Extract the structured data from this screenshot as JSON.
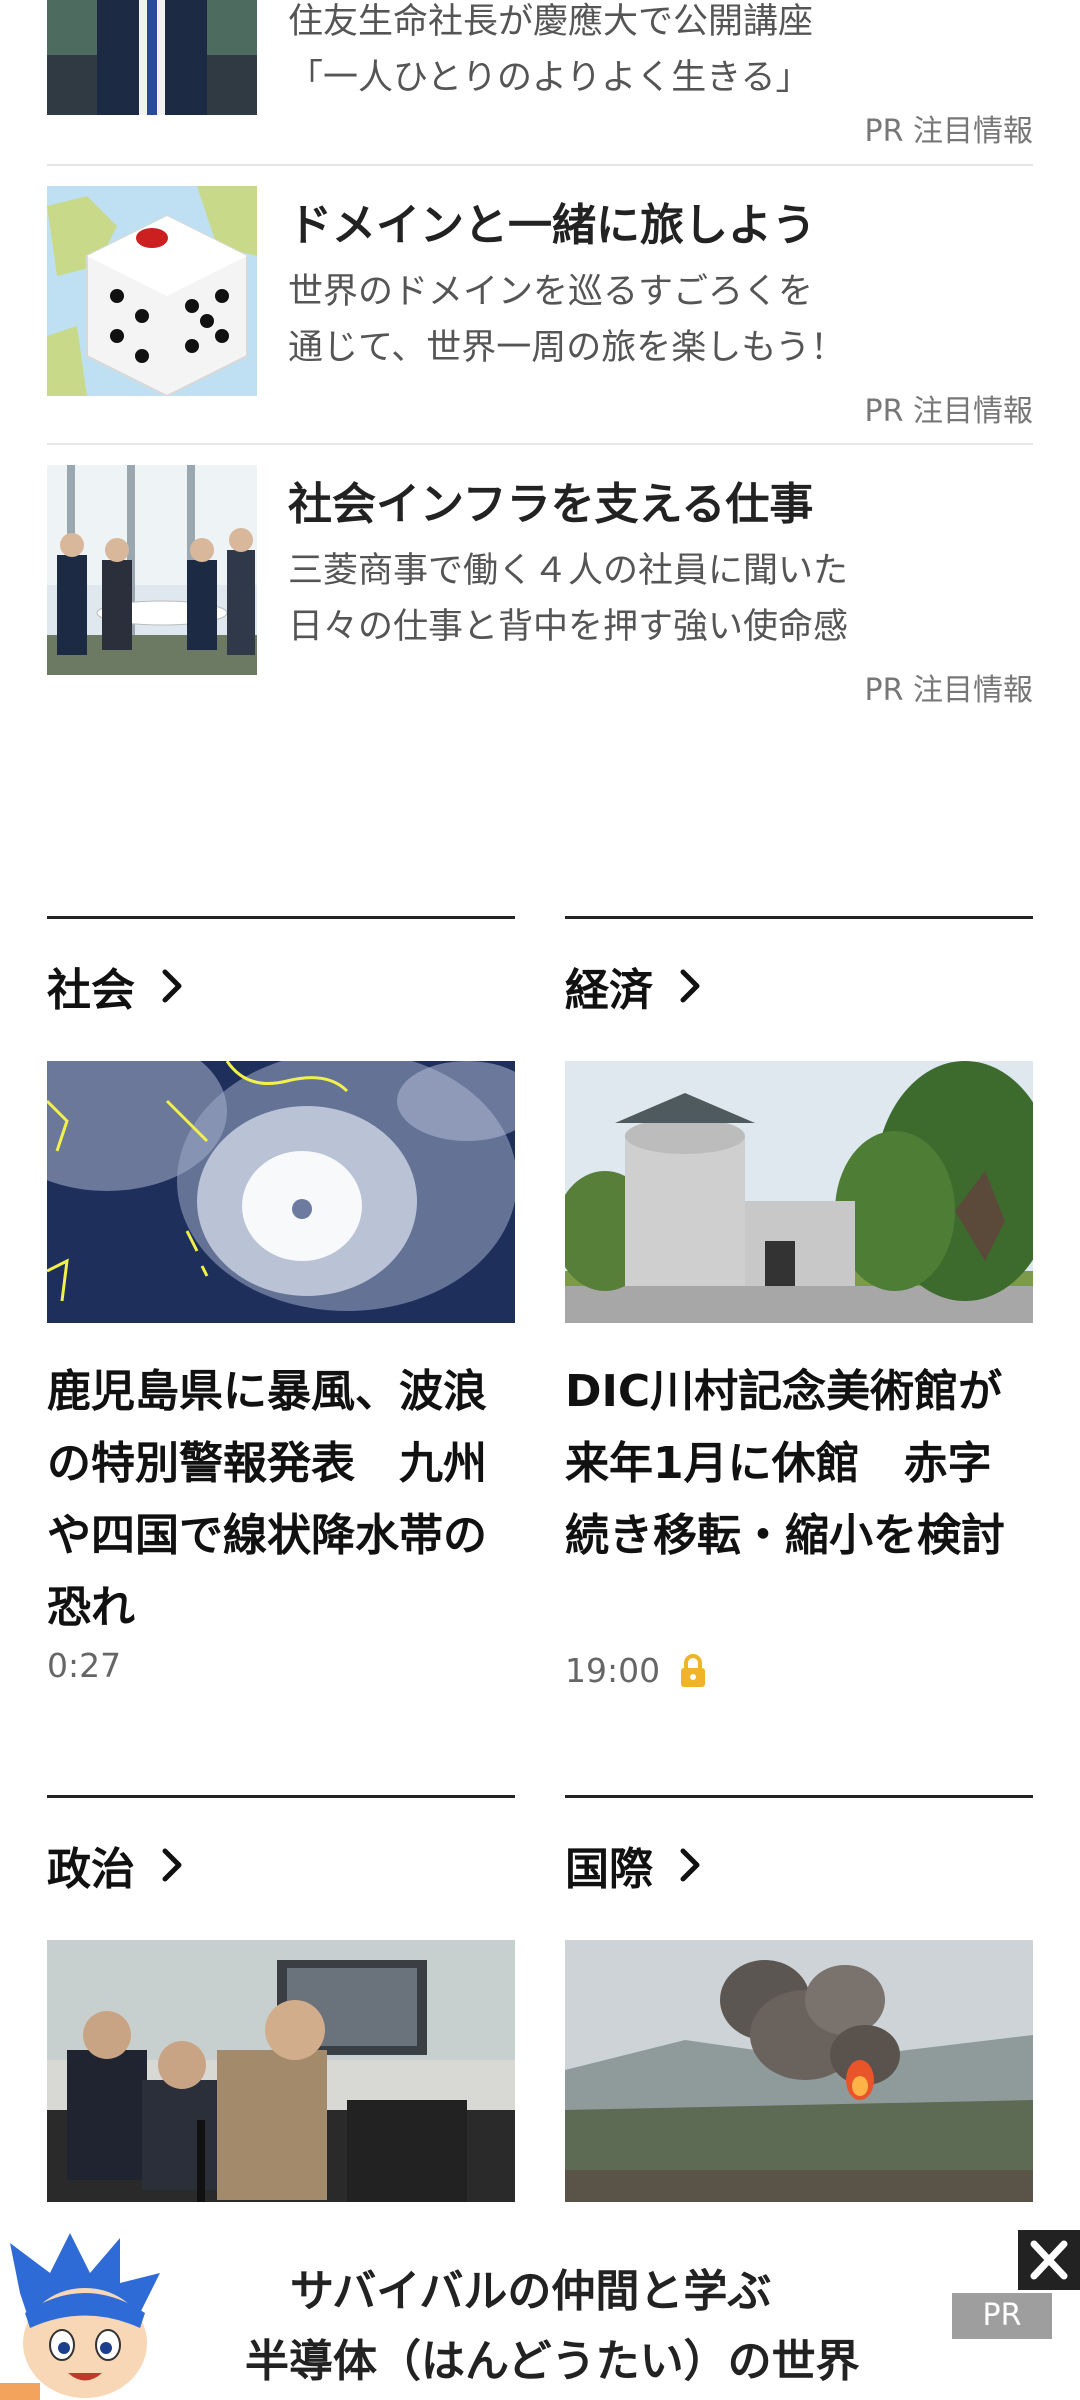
{
  "pr_items": [
    {
      "title": "住友生命社長が慶應大で公開講座",
      "desc": "「一人ひとりのよりよく生きる」",
      "tag": "PR 注目情報"
    },
    {
      "title": "ドメインと一緒に旅しよう",
      "desc_line1": "世界のドメインを巡るすごろくを",
      "desc_line2": "通じて、世界一周の旅を楽しもう！",
      "tag": "PR 注目情報"
    },
    {
      "title": "社会インフラを支える仕事",
      "desc_line1": "三菱商事で働く４人の社員に聞いた",
      "desc_line2": "日々の仕事と背中を押す強い使命感",
      "tag": "PR 注目情報"
    }
  ],
  "sections": {
    "shakai": {
      "label": "社会",
      "headline": "鹿児島県に暴風、波浪の特別警報発表　九州や四国で線状降水帯の恐れ",
      "time": "0:27"
    },
    "keizai": {
      "label": "経済",
      "headline": "DIC川村記念美術館が来年1月に休館　赤字続き移転・縮小を検討",
      "time": "19:00",
      "locked": true
    },
    "seiji": {
      "label": "政治"
    },
    "kokusai": {
      "label": "国際"
    }
  },
  "ad": {
    "line1": "サバイバルの仲間と学ぶ",
    "line2": "半導体（はんどうたい）の世界",
    "pr_label": "PR"
  },
  "colors": {
    "lock": "#f0b429",
    "rule": "#222222",
    "tag": "#777777"
  }
}
